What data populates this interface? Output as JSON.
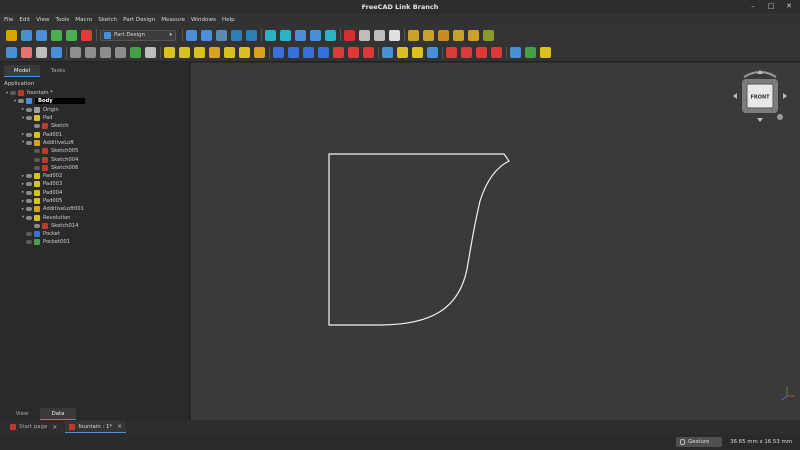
{
  "window": {
    "title": "FreeCAD Link Branch"
  },
  "menu": [
    "File",
    "Edit",
    "View",
    "Tools",
    "Macro",
    "Sketch",
    "Part Design",
    "Measure",
    "Windows",
    "Help"
  ],
  "workbench": {
    "selected": "Part Design"
  },
  "toolbar1": [
    {
      "name": "new-icon",
      "color": "#d9a400"
    },
    {
      "name": "open-icon",
      "color": "#4a90d9"
    },
    {
      "name": "save-icon",
      "color": "#4a90d9"
    },
    {
      "name": "undo-icon",
      "color": "#4caf50"
    },
    {
      "name": "redo-icon",
      "color": "#4caf50"
    },
    {
      "name": "refresh-icon",
      "color": "#e53935"
    },
    {
      "sep": true
    },
    {
      "wb": true
    },
    {
      "sep": true
    },
    {
      "name": "fit-all-icon",
      "color": "#4a90d9"
    },
    {
      "name": "fit-selection-icon",
      "color": "#4a90d9"
    },
    {
      "name": "draw-style-icon",
      "color": "#5c8ab6"
    },
    {
      "name": "std-view-icon",
      "color": "#2e7db5"
    },
    {
      "name": "view-front-icon",
      "color": "#2e7db5"
    },
    {
      "sep": true
    },
    {
      "name": "back-icon",
      "color": "#2bb2c6"
    },
    {
      "name": "forward-icon",
      "color": "#2bb2c6"
    },
    {
      "name": "link-icon",
      "color": "#4a90d9"
    },
    {
      "name": "measure-icon",
      "color": "#4a90d9"
    },
    {
      "name": "whats-this-icon",
      "color": "#2bb2c6"
    },
    {
      "sep": true
    },
    {
      "name": "macro-record-icon",
      "color": "#d32f2f"
    },
    {
      "name": "macro-stop-icon",
      "color": "#bdbdbd"
    },
    {
      "name": "macro-edit-icon",
      "color": "#bdbdbd"
    },
    {
      "name": "macro-run-icon",
      "color": "#e0e0e0"
    },
    {
      "sep": true
    },
    {
      "name": "sketch-new-icon",
      "color": "#c9a227"
    },
    {
      "name": "sketch-edit-icon",
      "color": "#c9a227"
    },
    {
      "name": "sketch-map-icon",
      "color": "#c98a27"
    },
    {
      "name": "sketch-reorient-icon",
      "color": "#c9a227"
    },
    {
      "name": "sketch-validate-icon",
      "color": "#c9a227"
    },
    {
      "name": "sketch-merge-icon",
      "color": "#8a9a27"
    }
  ],
  "toolbar2": [
    {
      "name": "body-icon",
      "color": "#4a90d9"
    },
    {
      "name": "part-icon",
      "color": "#e57373"
    },
    {
      "name": "shape-binder-icon",
      "color": "#bdbdbd"
    },
    {
      "name": "clone-icon",
      "color": "#4a90d9"
    },
    {
      "sep": true
    },
    {
      "name": "point-icon",
      "color": "#8e8e8e"
    },
    {
      "name": "line-icon",
      "color": "#8e8e8e"
    },
    {
      "name": "plane-icon",
      "color": "#8e8e8e"
    },
    {
      "name": "lcs-icon",
      "color": "#8e8e8e"
    },
    {
      "name": "sub-shape-binder-icon",
      "color": "#43a047"
    },
    {
      "name": "sprocket-icon",
      "color": "#bdbdbd"
    },
    {
      "sep": true
    },
    {
      "name": "pad-icon",
      "color": "#d9c21f"
    },
    {
      "name": "revolution-icon",
      "color": "#d9c21f"
    },
    {
      "name": "loft-icon",
      "color": "#d9c21f"
    },
    {
      "name": "pipe-icon",
      "color": "#d9a21f"
    },
    {
      "name": "helix-icon",
      "color": "#d9c21f"
    },
    {
      "name": "additive-box-icon",
      "color": "#d9c21f"
    },
    {
      "name": "additive-prim-icon",
      "color": "#d9a21f"
    },
    {
      "sep": true
    },
    {
      "name": "pocket-icon",
      "color": "#3a6fd9"
    },
    {
      "name": "hole-icon",
      "color": "#3a6fd9"
    },
    {
      "name": "groove-icon",
      "color": "#3a6fd9"
    },
    {
      "name": "subtractive-loft-icon",
      "color": "#3a6fd9"
    },
    {
      "name": "subtractive-pipe-icon",
      "color": "#d93a3a"
    },
    {
      "name": "subtractive-helix-icon",
      "color": "#d93a3a"
    },
    {
      "name": "subtractive-box-icon",
      "color": "#d93a3a"
    },
    {
      "sep": true
    },
    {
      "name": "mirror-icon",
      "color": "#4a90d9"
    },
    {
      "name": "linear-pattern-icon",
      "color": "#d9c21f"
    },
    {
      "name": "polar-pattern-icon",
      "color": "#d9c21f"
    },
    {
      "name": "multitransform-icon",
      "color": "#4a90d9"
    },
    {
      "sep": true
    },
    {
      "name": "fillet-icon",
      "color": "#d93a3a"
    },
    {
      "name": "chamfer-icon",
      "color": "#d93a3a"
    },
    {
      "name": "draft-icon",
      "color": "#d93a3a"
    },
    {
      "name": "thickness-icon",
      "color": "#d93a3a"
    },
    {
      "sep": true
    },
    {
      "name": "boolean-icon",
      "color": "#4a90d9"
    },
    {
      "name": "sketch-attach-icon",
      "color": "#43a047"
    },
    {
      "name": "sketch-close-icon",
      "color": "#d9c21f"
    }
  ],
  "panel": {
    "tabs": [
      "Model",
      "Tasks"
    ],
    "bottom_tabs": [
      "View",
      "Data"
    ],
    "header": "Application",
    "tree": [
      {
        "label": "fountain *",
        "indent": 0,
        "exp": "▾",
        "icon": "#c0392b",
        "eye": false
      },
      {
        "label": "Body",
        "indent": 1,
        "exp": "▾",
        "icon": "#4a90d9",
        "eye": true,
        "selected": true
      },
      {
        "label": "Origin",
        "indent": 2,
        "exp": "▸",
        "icon": "#9e9e9e",
        "eye": true
      },
      {
        "label": "Pad",
        "indent": 2,
        "exp": "▾",
        "icon": "#d9c21f",
        "eye": true
      },
      {
        "label": "Sketch",
        "indent": 3,
        "exp": "",
        "icon": "#c0392b",
        "eye": true
      },
      {
        "label": "Pad001",
        "indent": 2,
        "exp": "▸",
        "icon": "#d9c21f",
        "eye": true
      },
      {
        "label": "AdditiveLoft",
        "indent": 2,
        "exp": "▾",
        "icon": "#d9a21f",
        "eye": true
      },
      {
        "label": "Sketch005",
        "indent": 3,
        "exp": "",
        "icon": "#c0392b",
        "eye": false
      },
      {
        "label": "Sketch004",
        "indent": 3,
        "exp": "",
        "icon": "#c0392b",
        "eye": false
      },
      {
        "label": "Sketch006",
        "indent": 3,
        "exp": "",
        "icon": "#c0392b",
        "eye": false
      },
      {
        "label": "Pad002",
        "indent": 2,
        "exp": "▸",
        "icon": "#d9c21f",
        "eye": true
      },
      {
        "label": "Pad003",
        "indent": 2,
        "exp": "▸",
        "icon": "#d9c21f",
        "eye": true
      },
      {
        "label": "Pad004",
        "indent": 2,
        "exp": "▸",
        "icon": "#d9c21f",
        "eye": true
      },
      {
        "label": "Pad005",
        "indent": 2,
        "exp": "▸",
        "icon": "#d9c21f",
        "eye": true
      },
      {
        "label": "AdditiveLoft001",
        "indent": 2,
        "exp": "▸",
        "icon": "#d9a21f",
        "eye": true
      },
      {
        "label": "Revolution",
        "indent": 2,
        "exp": "▾",
        "icon": "#d9c21f",
        "eye": true
      },
      {
        "label": "Sketch014",
        "indent": 3,
        "exp": "",
        "icon": "#c0392b",
        "eye": true
      },
      {
        "label": "Pocket",
        "indent": 2,
        "exp": "",
        "icon": "#3a6fd9",
        "eye": false
      },
      {
        "label": "Pocket001",
        "indent": 2,
        "exp": "",
        "icon": "#43a047",
        "eye": false
      }
    ]
  },
  "navcube": {
    "face": "FRONT"
  },
  "doc_tabs": [
    {
      "label": "Start page",
      "active": false
    },
    {
      "label": "fountain : 1*",
      "active": true
    }
  ],
  "status": {
    "nav_style": "Gesture",
    "dimensions": "36.65 mm x 16.53 mm"
  }
}
